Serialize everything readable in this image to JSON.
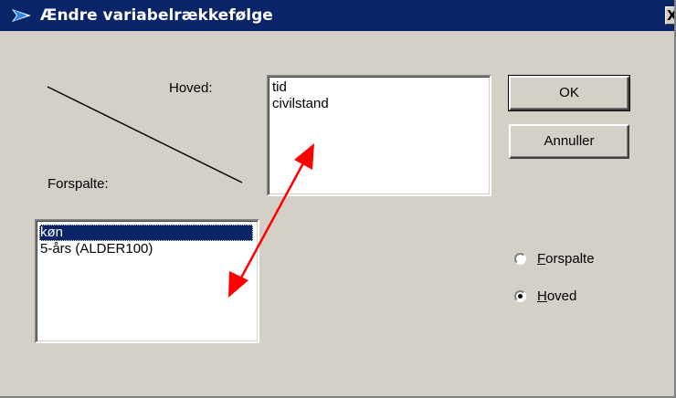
{
  "window": {
    "title": "Ændre variabelrækkefølge",
    "close_glyph": "X",
    "icon": "swap-arrow-icon"
  },
  "labels": {
    "hoved": "Hoved:",
    "forspalte": "Forspalte:"
  },
  "hoved_list": {
    "items": [
      "tid",
      "civilstand"
    ]
  },
  "forspalte_list": {
    "items": [
      "køn",
      "5-års (ALDER100)"
    ],
    "selected_index": 0
  },
  "buttons": {
    "ok": "OK",
    "cancel": "Annuller"
  },
  "radio": {
    "options": [
      {
        "label": "Forspalte",
        "mnemonic": "F",
        "rest": "orspalte",
        "checked": false
      },
      {
        "label": "Hoved",
        "mnemonic": "H",
        "rest": "oved",
        "checked": true
      }
    ]
  },
  "colors": {
    "title_bar": "#0a246a",
    "selection": "#0a246a",
    "face": "#d4d0c8",
    "annotation_arrow": "#ff0000"
  }
}
